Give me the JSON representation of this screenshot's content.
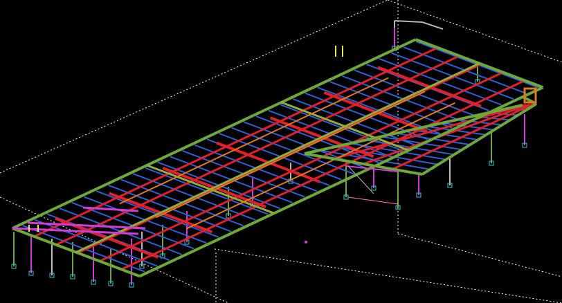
{
  "viewport": {
    "background": "#000000",
    "description_visible_text": ""
  },
  "colors": {
    "grid": "#ffffff",
    "green": "#6fa83a",
    "olive": "#8fae3e",
    "red": "#e0202a",
    "blue": "#2f5fd8",
    "magenta": "#d23bd8",
    "orange": "#e07a1e",
    "yellow": "#e8e84a",
    "cyan": "#33c8d0",
    "pink": "#ff7fb8",
    "gray": "#b8b8b8"
  },
  "model": {
    "name": "",
    "view": "isometric"
  }
}
